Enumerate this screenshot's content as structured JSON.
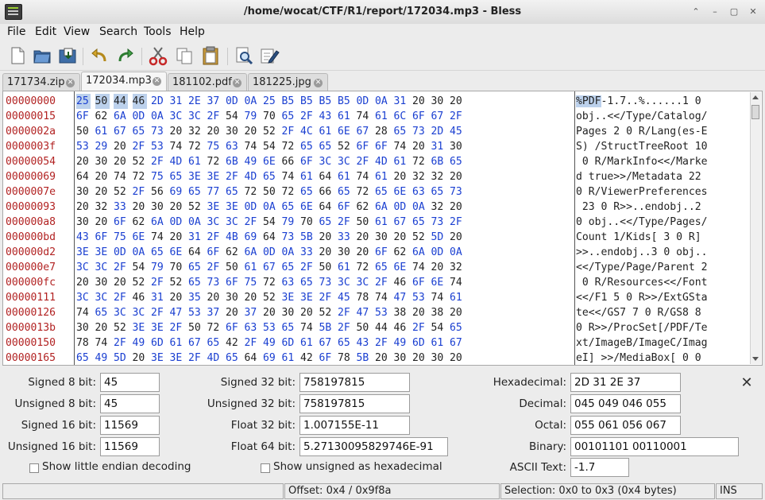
{
  "window": {
    "title": "/home/wocat/CTF/R1/report/172034.mp3 - Bless",
    "controls": [
      "up-arrow-icon",
      "minimize-icon",
      "maximize-icon",
      "close-icon"
    ]
  },
  "menu": [
    "File",
    "Edit",
    "View",
    "Search",
    "Tools",
    "Help"
  ],
  "toolbar": [
    "new-file-icon",
    "open-folder-icon",
    "save-icon",
    "undo-icon",
    "redo-icon",
    "cut-icon",
    "copy-icon",
    "paste-icon",
    "find-icon",
    "edit-icon"
  ],
  "tabs": [
    {
      "label": "171734.zip",
      "active": false
    },
    {
      "label": "172034.mp3",
      "active": true
    },
    {
      "label": "181102.pdf",
      "active": false
    },
    {
      "label": "181225.jpg",
      "active": false
    }
  ],
  "hex": {
    "offsets": [
      "00000000",
      "00000015",
      "0000002a",
      "0000003f",
      "00000054",
      "00000069",
      "0000007e",
      "00000093",
      "000000a8",
      "000000bd",
      "000000d2",
      "000000e7",
      "000000fc",
      "00000111",
      "00000126",
      "0000013b",
      "00000150",
      "00000165"
    ],
    "rows": [
      "25 50 44 46 2D 31 2E 37 0D 0A 25 B5 B5 B5 B5 0D 0A 31 20 30 20",
      "6F 62 6A 0D 0A 3C 3C 2F 54 79 70 65 2F 43 61 74 61 6C 6F 67 2F",
      "50 61 67 65 73 20 32 20 30 20 52 2F 4C 61 6E 67 28 65 73 2D 45",
      "53 29 20 2F 53 74 72 75 63 74 54 72 65 65 52 6F 6F 74 20 31 30",
      "20 30 20 52 2F 4D 61 72 6B 49 6E 66 6F 3C 3C 2F 4D 61 72 6B 65",
      "64 20 74 72 75 65 3E 3E 2F 4D 65 74 61 64 61 74 61 20 32 32 20",
      "30 20 52 2F 56 69 65 77 65 72 50 72 65 66 65 72 65 6E 63 65 73",
      "20 32 33 20 30 20 52 3E 3E 0D 0A 65 6E 64 6F 62 6A 0D 0A 32 20",
      "30 20 6F 62 6A 0D 0A 3C 3C 2F 54 79 70 65 2F 50 61 67 65 73 2F",
      "43 6F 75 6E 74 20 31 2F 4B 69 64 73 5B 20 33 20 30 20 52 5D 20",
      "3E 3E 0D 0A 65 6E 64 6F 62 6A 0D 0A 33 20 30 20 6F 62 6A 0D 0A",
      "3C 3C 2F 54 79 70 65 2F 50 61 67 65 2F 50 61 72 65 6E 74 20 32",
      "20 30 20 52 2F 52 65 73 6F 75 72 63 65 73 3C 3C 2F 46 6F 6E 74",
      "3C 3C 2F 46 31 20 35 20 30 20 52 3E 3E 2F 45 78 74 47 53 74 61",
      "74 65 3C 3C 2F 47 53 37 20 37 20 30 20 52 2F 47 53 38 20 38 20",
      "30 20 52 3E 3E 2F 50 72 6F 63 53 65 74 5B 2F 50 44 46 2F 54 65",
      "78 74 2F 49 6D 61 67 65 42 2F 49 6D 61 67 65 43 2F 49 6D 61 67",
      "65 49 5D 20 3E 3E 2F 4D 65 64 69 61 42 6F 78 5B 20 30 20 30 20"
    ],
    "ascii": [
      "%PDF-1.7..%......1 0 ",
      "obj..<</Type/Catalog/",
      "Pages 2 0 R/Lang(es-E",
      "S) /StructTreeRoot 10",
      " 0 R/MarkInfo<</Marke",
      "d true>>/Metadata 22 ",
      "0 R/ViewerPreferences",
      " 23 0 R>>..endobj..2 ",
      "0 obj..<</Type/Pages/",
      "Count 1/Kids[ 3 0 R] ",
      ">>..endobj..3 0 obj..",
      "<</Type/Page/Parent 2",
      " 0 R/Resources<</Font",
      "<</F1 5 0 R>>/ExtGSta",
      "te<</GS7 7 0 R/GS8 8 ",
      "0 R>>/ProcSet[/PDF/Te",
      "xt/ImageB/ImageC/Imag",
      "eI] >>/MediaBox[ 0 0 "
    ],
    "selection_bytes": 4
  },
  "conversion": {
    "signed8_label": "Signed 8 bit:",
    "signed8": "45",
    "unsigned8_label": "Unsigned 8 bit:",
    "unsigned8": "45",
    "signed16_label": "Signed 16 bit:",
    "signed16": "11569",
    "unsigned16_label": "Unsigned 16 bit:",
    "unsigned16": "11569",
    "signed32_label": "Signed 32 bit:",
    "signed32": "758197815",
    "unsigned32_label": "Unsigned 32 bit:",
    "unsigned32": "758197815",
    "float32_label": "Float 32 bit:",
    "float32": "1.007155E-11",
    "float64_label": "Float 64 bit:",
    "float64": "5.27130095829746E-91",
    "hex_label": "Hexadecimal:",
    "hex": "2D 31 2E 37",
    "dec_label": "Decimal:",
    "dec": "045 049 046 055",
    "oct_label": "Octal:",
    "oct": "055 061 056 067",
    "bin_label": "Binary:",
    "bin": "00101101 00110001 00101110",
    "ascii_label": "ASCII Text:",
    "ascii": "-1.7",
    "little_endian_label": "Show little endian decoding",
    "unsigned_hex_label": "Show unsigned as hexadecimal"
  },
  "status": {
    "left": "",
    "offset": "Offset: 0x4 / 0x9f8a",
    "selection": "Selection: 0x0 to 0x3 (0x4 bytes)",
    "mode": "INS"
  }
}
